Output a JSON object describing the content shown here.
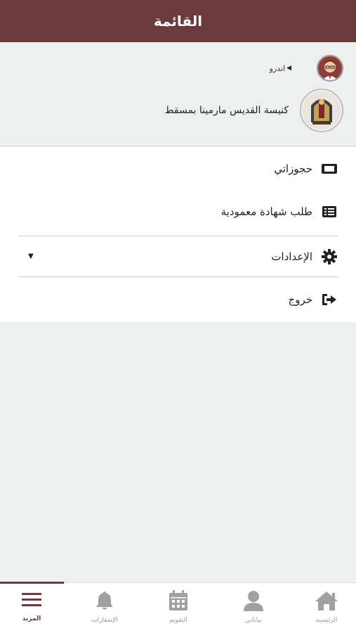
{
  "header": {
    "title": "القائمة"
  },
  "profile": {
    "user_name": "اندرو",
    "church_name": "كنيسة القديس مارمينا بمسقط"
  },
  "menu": {
    "items": [
      {
        "label": "حجوزاتي",
        "icon": "ticket-icon"
      },
      {
        "label": "طلب شهادة معمودية",
        "icon": "list-icon"
      },
      {
        "label": "الإعدادات",
        "icon": "gear-icon"
      },
      {
        "label": "خروج",
        "icon": "sign-out-icon"
      }
    ]
  },
  "tabbar": {
    "tabs": [
      {
        "label": "المزيد",
        "icon": "menu-icon",
        "active": true
      },
      {
        "label": "الإشعارات",
        "icon": "bell-icon",
        "active": false
      },
      {
        "label": "التقويم",
        "icon": "calendar-icon",
        "active": false
      },
      {
        "label": "بياناتي",
        "icon": "user-icon",
        "active": false
      },
      {
        "label": "الرئيسية",
        "icon": "home-icon",
        "active": false
      }
    ]
  },
  "colors": {
    "primary": "#6b3a3d",
    "background": "#eeefef",
    "icon_inactive": "#a0a0a0"
  }
}
